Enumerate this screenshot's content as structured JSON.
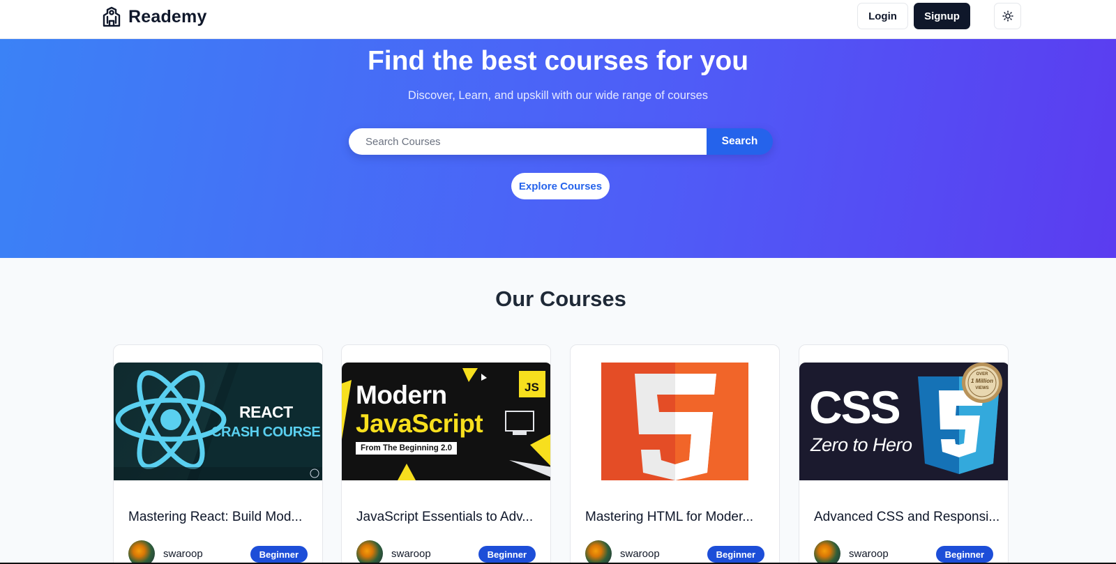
{
  "brand": {
    "name": "Reademy",
    "icon": "school-icon"
  },
  "nav": {
    "login_label": "Login",
    "signup_label": "Signup",
    "theme_icon": "sun-icon"
  },
  "hero": {
    "title": "Find the best courses for you",
    "subtitle": "Discover, Learn, and upskill with our wide range of courses",
    "search_placeholder": "Search Courses",
    "search_button": "Search",
    "explore_button": "Explore Courses"
  },
  "courses": {
    "heading": "Our Courses",
    "items": [
      {
        "title": "Mastering React: Build Mod...",
        "author": "swaroop",
        "level": "Beginner",
        "thumb_lines": [
          "REACT",
          "CRASH COURSE"
        ]
      },
      {
        "title": "JavaScript Essentials to Adv...",
        "author": "swaroop",
        "level": "Beginner",
        "thumb_lines": [
          "Modern",
          "JavaScript",
          "From The Beginning 2.0",
          "JS"
        ]
      },
      {
        "title": "Mastering HTML for Moder...",
        "author": "swaroop",
        "level": "Beginner",
        "thumb_lines": [
          "5"
        ]
      },
      {
        "title": "Advanced CSS and Responsi...",
        "author": "swaroop",
        "level": "Beginner",
        "thumb_lines": [
          "CSS",
          "Zero to Hero",
          "3",
          "OVER",
          "1 Million",
          "VIEWS"
        ]
      }
    ]
  },
  "colors": {
    "hero_start": "#3b82f6",
    "hero_end": "#5b3cf0",
    "accent": "#2563eb",
    "dark": "#0f172a",
    "badge": "#1d4ed8"
  }
}
